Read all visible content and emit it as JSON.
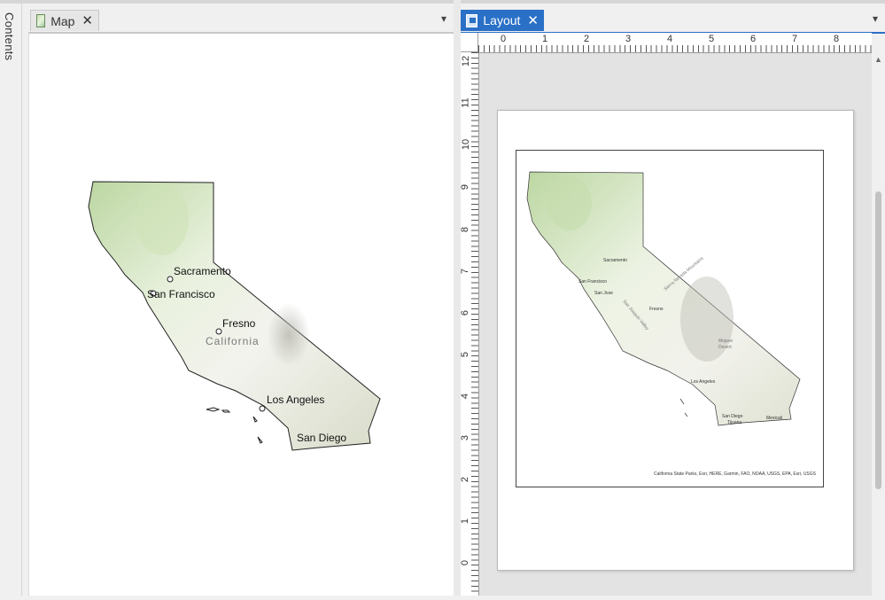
{
  "contents_panel": {
    "label": "Contents"
  },
  "map_view": {
    "tab_label": "Map",
    "icon": "map-icon",
    "cities": [
      "Sacramento",
      "San Francisco",
      "Fresno",
      "Los Angeles",
      "San Diego"
    ],
    "state_label": "California"
  },
  "layout_view": {
    "tab_label": "Layout",
    "icon": "layout-icon",
    "ruler_top": [
      "0",
      "1",
      "2",
      "3",
      "4",
      "5",
      "6",
      "7",
      "8"
    ],
    "ruler_left": [
      "12",
      "11",
      "10",
      "9",
      "8",
      "7",
      "6",
      "5",
      "4",
      "3",
      "2",
      "1",
      "0"
    ],
    "map_labels": {
      "sacramento": "Sacramento",
      "san_francisco": "San Francisco",
      "san_jose": "San Jose",
      "fresno": "Fresno",
      "los_angeles": "Los Angeles",
      "san_diego": "San Diego",
      "tijuana": "Tijuana",
      "mexicali": "Mexicali",
      "mojave": "Mojave",
      "desert": "Desert",
      "sierra_nevada": "Sierra Nevada Mountains",
      "san_joaquin": "San Joaquin Valley"
    },
    "attribution": "California State Parks, Esri, HERE, Garmin, FAO, NOAA, USGS, EPA, Esri, USGS"
  },
  "colors": {
    "active_tab": "#2a70c6",
    "terrain_green": "#c8deb0",
    "boundary": "#222222"
  }
}
